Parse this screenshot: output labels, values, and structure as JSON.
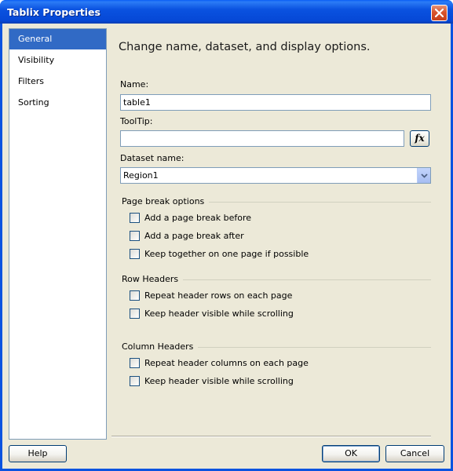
{
  "window": {
    "title": "Tablix Properties"
  },
  "nav": {
    "items": [
      {
        "label": "General",
        "selected": true
      },
      {
        "label": "Visibility",
        "selected": false
      },
      {
        "label": "Filters",
        "selected": false
      },
      {
        "label": "Sorting",
        "selected": false
      }
    ]
  },
  "main": {
    "heading": "Change name, dataset, and display options.",
    "name": {
      "label": "Name:",
      "value": "table1"
    },
    "tooltip": {
      "label": "ToolTip:",
      "value": "",
      "expression_button": "fx"
    },
    "dataset": {
      "label": "Dataset name:",
      "value": "Region1"
    },
    "page_break": {
      "title": "Page break options",
      "options": [
        {
          "label": "Add a page break before",
          "checked": false
        },
        {
          "label": "Add a page break after",
          "checked": false
        },
        {
          "label": "Keep together on one page if possible",
          "checked": false
        }
      ]
    },
    "row_headers": {
      "title": "Row Headers",
      "options": [
        {
          "label": "Repeat header rows on each page",
          "checked": false
        },
        {
          "label": "Keep header visible while scrolling",
          "checked": false
        }
      ]
    },
    "column_headers": {
      "title": "Column Headers",
      "options": [
        {
          "label": "Repeat header columns on each page",
          "checked": false
        },
        {
          "label": "Keep header visible while scrolling",
          "checked": false
        }
      ]
    }
  },
  "footer": {
    "help": "Help",
    "ok": "OK",
    "cancel": "Cancel"
  },
  "colors": {
    "title_bar": "#0a52e0",
    "selection": "#316ac5",
    "dialog_bg": "#ece9d8"
  }
}
